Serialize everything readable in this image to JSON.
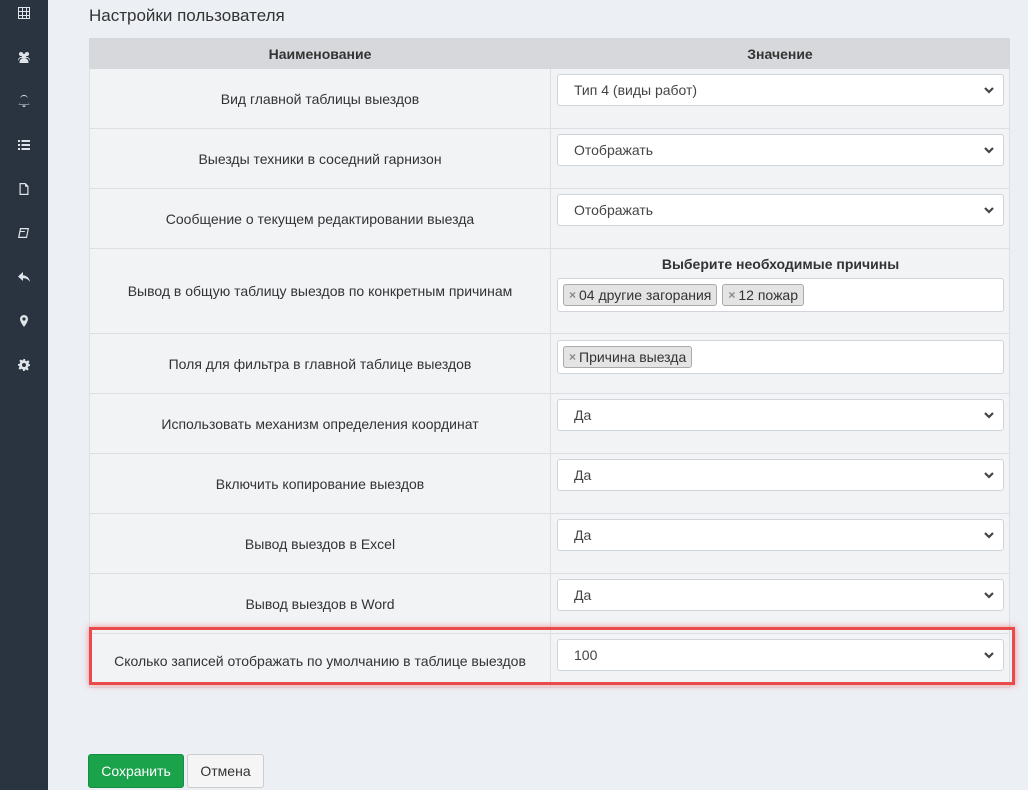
{
  "sidebar": {
    "icons": [
      "table-icon",
      "users-icon",
      "bell-icon",
      "list-icon",
      "file-icon",
      "book-icon",
      "reply-icon",
      "map-marker-icon",
      "gear-icon"
    ]
  },
  "page": {
    "title": "Настройки пользователя"
  },
  "table": {
    "headers": {
      "name": "Наименование",
      "value": "Значение"
    },
    "rows": [
      {
        "label": "Вид главной таблицы выездов",
        "value": "Тип 4 (виды работ)"
      },
      {
        "label": "Выезды техники в соседний гарнизон",
        "value": "Отображать"
      },
      {
        "label": "Сообщение о текущем редактировании выезда",
        "value": "Отображать"
      },
      {
        "label": "Вывод в общую таблицу выездов по конкретным причинам",
        "multi_title": "Выберите необходимые причины",
        "tags": [
          "04 другие загорания",
          "12 пожар"
        ]
      },
      {
        "label": "Поля для фильтра в главной таблице выездов",
        "tags": [
          "Причина выезда"
        ]
      },
      {
        "label": "Использовать механизм определения координат",
        "value": "Да"
      },
      {
        "label": "Включить копирование выездов",
        "value": "Да"
      },
      {
        "label": "Вывод выездов в Excel",
        "value": "Да"
      },
      {
        "label": "Вывод выездов в Word",
        "value": "Да"
      },
      {
        "label": "Сколько записей отображать по умолчанию в таблице выездов",
        "value": "100"
      }
    ]
  },
  "tag_remove_symbol": "×",
  "buttons": {
    "save": "Сохранить",
    "cancel": "Отмена"
  },
  "colors": {
    "sidebar": "#2a3440",
    "highlight": "#e94a4c",
    "save": "#1aa34a"
  }
}
